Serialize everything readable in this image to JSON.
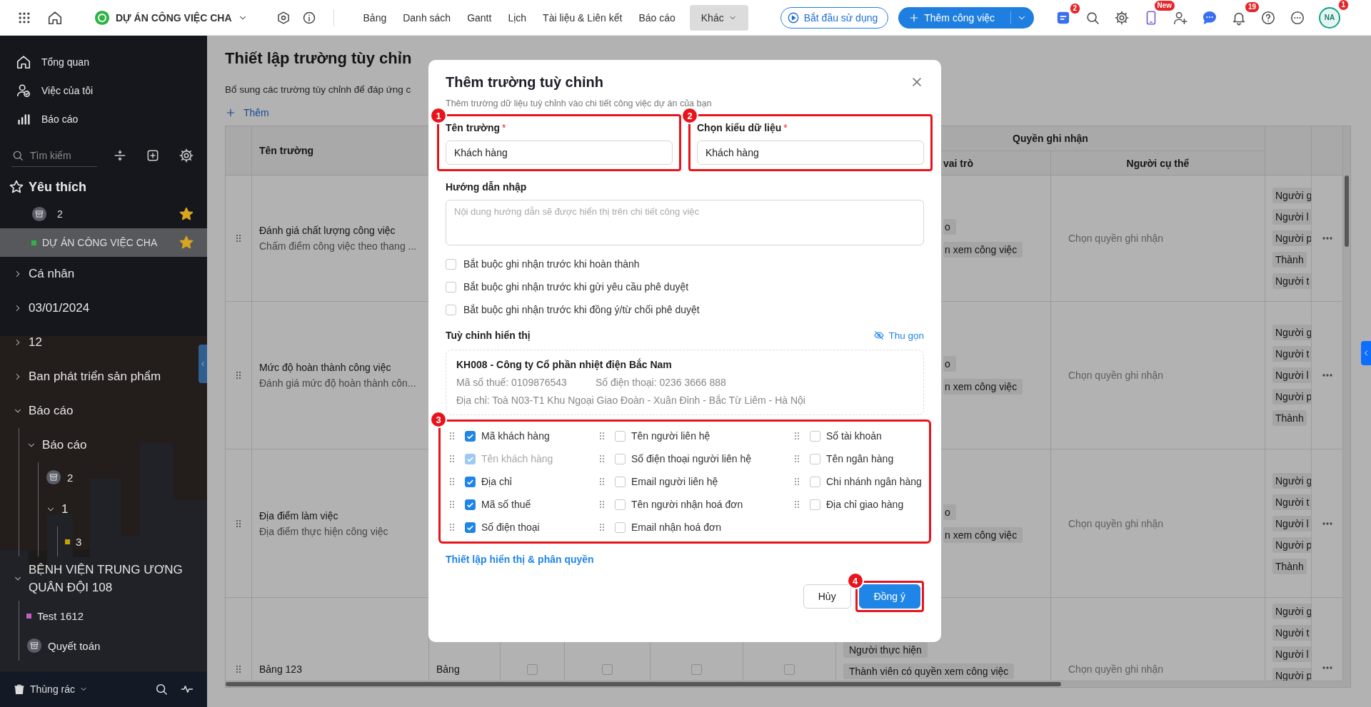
{
  "topbar": {
    "project": "DỰ ÁN CÔNG VIỆC CHA",
    "tabs": [
      {
        "label": "Bảng",
        "selected": false
      },
      {
        "label": "Danh sách",
        "selected": false
      },
      {
        "label": "Gantt",
        "selected": false
      },
      {
        "label": "Lịch",
        "selected": false
      },
      {
        "label": "Tài liệu & Liên kết",
        "selected": false
      },
      {
        "label": "Báo cáo",
        "selected": false
      },
      {
        "label": "Khác",
        "selected": true
      }
    ],
    "start_button": "Bắt đầu sử dụng",
    "add_button": "Thêm công việc",
    "icons": [
      {
        "kind": "apps",
        "badge": "2"
      },
      {
        "kind": "search"
      },
      {
        "kind": "settings"
      },
      {
        "kind": "phone",
        "badge": "New"
      },
      {
        "kind": "add-user"
      },
      {
        "kind": "chat"
      },
      {
        "kind": "bell",
        "badge": "19"
      },
      {
        "kind": "help"
      },
      {
        "kind": "more"
      }
    ],
    "avatar": {
      "initials": "NA",
      "badge": "1"
    }
  },
  "sidebar": {
    "nav": [
      {
        "label": "Tổng quan",
        "kind": "home"
      },
      {
        "label": "Việc của tôi",
        "kind": "user-check"
      },
      {
        "label": "Báo cáo",
        "kind": "chart"
      }
    ],
    "search_placeholder": "Tìm kiếm",
    "favorites_title": "Yêu thích",
    "favorites": [
      {
        "label": "2",
        "kind": "archive",
        "selected": false
      },
      {
        "label": "DỰ ÁN CÔNG VIỆC CHA",
        "kind": "project",
        "color": "#2fb344",
        "selected": true
      }
    ],
    "tree": [
      {
        "label": "Cá nhân",
        "kind": "group",
        "expanded": false
      },
      {
        "label": "03/01/2024",
        "kind": "group",
        "expanded": false
      },
      {
        "label": "12",
        "kind": "group",
        "expanded": false
      },
      {
        "label": "Ban phát triển sản phẩm",
        "kind": "group",
        "expanded": false
      },
      {
        "label": "Báo cáo",
        "kind": "group",
        "expanded": true,
        "children": [
          {
            "label": "Báo cáo",
            "kind": "group",
            "expanded": true,
            "children": [
              {
                "label": "2",
                "kind": "archive"
              },
              {
                "label": "1",
                "kind": "group",
                "expanded": true,
                "children": [
                  {
                    "label": "3",
                    "kind": "project",
                    "color": "#c9a000"
                  }
                ]
              }
            ]
          }
        ]
      },
      {
        "label": "BỆNH VIỆN TRUNG ƯƠNG QUÂN ĐỘI 108",
        "kind": "group",
        "expanded": true,
        "children": [
          {
            "label": "Test 1612",
            "kind": "project",
            "color": "#c45ec4"
          },
          {
            "label": "Quyết toán",
            "kind": "archive"
          }
        ]
      }
    ],
    "trash": "Thùng rác"
  },
  "page": {
    "title": "Thiết lập trường tùy chỉn",
    "description": "Bổ sung các trường tùy chỉnh để đáp ứng c",
    "add_link": "Thêm"
  },
  "table": {
    "name_header": "Tên trường",
    "group_header": "Quyền ghi nhận",
    "role_header": "vai trò",
    "person_header": "Người cụ thể",
    "rows": [
      {
        "name": "Đánh giá chất lượng công việc",
        "description": "Chấm điểm công việc theo thang ...",
        "role_cut": true,
        "role_tags": [
          "o",
          "n xem công việc"
        ],
        "person_placeholder": "Chọn quyền ghi nhận",
        "tags": [
          "Người g",
          "Người l",
          "Người p",
          "Thành",
          "Người t"
        ]
      },
      {
        "name": "Mức độ hoàn thành công việc",
        "description": "Đánh giá mức độ hoàn thành côn...",
        "role_cut": true,
        "role_tags": [
          "o",
          "n xem công việc"
        ],
        "person_placeholder": "Chọn quyền ghi nhận",
        "tags": [
          "Người g",
          "Người t",
          "Người l",
          "Người p",
          "Thành"
        ]
      },
      {
        "name": "Địa điểm làm việc",
        "description": "Địa điểm thực hiện công việc",
        "role_cut": true,
        "role_tags": [
          "o",
          "n xem công việc"
        ],
        "person_placeholder": "Chọn quyền ghi nhận",
        "tags": [
          "Người g",
          "Người t",
          "Người l",
          "Người p",
          "Thành"
        ]
      },
      {
        "name": "Bảng 123",
        "type": "Bảng",
        "checks": [
          false,
          false,
          false,
          false
        ],
        "role_cut": false,
        "role_tags": [
          "Người thực hiện",
          "Thành viên có quyền xem công việc"
        ],
        "person_placeholder": "Chọn quyền ghi nhận",
        "tags": [
          "Người g",
          "Người t",
          "Người l",
          "Người p"
        ]
      }
    ]
  },
  "dialog": {
    "title": "Thêm trường tuỳ chỉnh",
    "subtitle": "Thêm trường dữ liệu tuỳ chỉnh vào chi tiết công việc dự án của bạn",
    "fields": [
      {
        "label": "Tên trường",
        "required_mark": "*",
        "value": "Khách hàng",
        "marker": "1"
      },
      {
        "label": "Chọn kiểu dữ liệu",
        "required_mark": "*",
        "value": "Khách hàng",
        "marker": "2"
      }
    ],
    "guide": {
      "label": "Hướng dẫn nhập",
      "placeholder": "Nội dung hướng dẫn sẽ được hiển thị trên chi tiết công việc"
    },
    "requirements": [
      {
        "label": "Bắt buộc ghi nhận trước khi hoàn thành",
        "checked": false
      },
      {
        "label": "Bắt buộc ghi nhận trước khi gửi yêu cầu phê duyệt",
        "checked": false
      },
      {
        "label": "Bắt buộc ghi nhận trước khi đồng ý/từ chối phê duyệt",
        "checked": false
      }
    ],
    "display_title": "Tuỳ chỉnh hiển thị",
    "collapse_link": "Thu gọn",
    "preview": {
      "title": "KH008 - Công ty Cổ phần nhiệt điện Bắc Nam",
      "tax": "Mã số thuế: 0109876543",
      "phone": "Số điện thoại: 0236 3666 888",
      "address": "Địa chỉ: Toà N03-T1 Khu Ngoại Giao Đoàn - Xuân Đỉnh - Bắc Từ Liêm - Hà Nội"
    },
    "attributes_marker": "3",
    "attribute_columns": [
      [
        {
          "label": "Mã khách hàng",
          "checked": true,
          "disabled": false
        },
        {
          "label": "Tên khách hàng",
          "checked": true,
          "disabled": true
        },
        {
          "label": "Địa chỉ",
          "checked": true,
          "disabled": false
        },
        {
          "label": "Mã số thuế",
          "checked": true,
          "disabled": false
        },
        {
          "label": "Số điện thoại",
          "checked": true,
          "disabled": false
        }
      ],
      [
        {
          "label": "Tên người liên hệ",
          "checked": false,
          "disabled": false
        },
        {
          "label": "Số điện thoại người liên hệ",
          "checked": false,
          "disabled": false
        },
        {
          "label": "Email người liên hệ",
          "checked": false,
          "disabled": false
        },
        {
          "label": "Tên người nhận hoá đơn",
          "checked": false,
          "disabled": false
        },
        {
          "label": "Email nhận hoá đơn",
          "checked": false,
          "disabled": false
        }
      ],
      [
        {
          "label": "Số tài khoản",
          "checked": false,
          "disabled": false
        },
        {
          "label": "Tên ngân hàng",
          "checked": false,
          "disabled": false
        },
        {
          "label": "Chi nhánh ngân hàng",
          "checked": false,
          "disabled": false
        },
        {
          "label": "Địa chỉ giao hàng",
          "checked": false,
          "disabled": false
        }
      ]
    ],
    "settings_link": "Thiết lập hiển thị & phân quyền",
    "cancel": "Hủy",
    "confirm": "Đồng ý",
    "confirm_marker": "4"
  }
}
